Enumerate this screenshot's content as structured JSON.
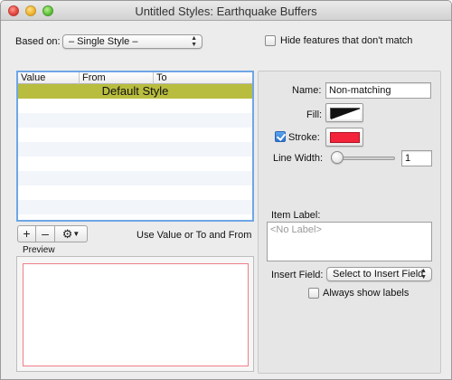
{
  "window": {
    "title": "Untitled Styles: Earthquake  Buffers"
  },
  "top": {
    "based_on_label": "Based on:",
    "based_on_value": "– Single Style –",
    "hide_features_label": "Hide features that don't match",
    "hide_features_checked": false
  },
  "table": {
    "columns": [
      "Value",
      "From",
      "To"
    ],
    "selected_row_label": "Default Style",
    "selected_row_color": "#b9bd3f"
  },
  "toolbar": {
    "add_label": "+",
    "remove_label": "–",
    "hint": "Use Value or To and From"
  },
  "preview": {
    "label": "Preview"
  },
  "style": {
    "name_label": "Name:",
    "name_value": "Non-matching",
    "fill_label": "Fill:",
    "stroke_label": "Stroke:",
    "stroke_checked": true,
    "stroke_color": "#f2233a",
    "line_width_label": "Line Width:",
    "line_width_value": "1",
    "item_label_label": "Item Label:",
    "item_label_placeholder": "<No Label>",
    "insert_field_label": "Insert Field:",
    "insert_field_value": "Select to Insert Field",
    "always_show_labels": "Always show labels",
    "always_show_checked": false
  }
}
